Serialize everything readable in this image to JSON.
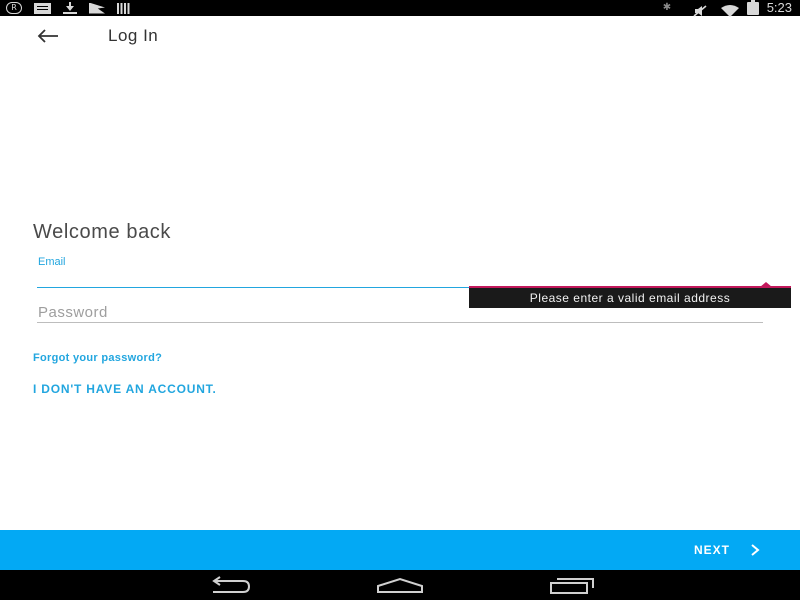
{
  "status_bar": {
    "left_icons": [
      "r-badge-icon",
      "message-icon",
      "download-icon",
      "play-store-icon",
      "barcode-icon"
    ],
    "right_icons": [
      "bluetooth-icon",
      "mute-icon",
      "wifi-icon",
      "battery-icon"
    ],
    "r_badge": "R",
    "time": "5:23"
  },
  "toolbar": {
    "back_icon": "arrow-left-icon",
    "title": "Log In"
  },
  "form": {
    "heading": "Welcome back",
    "email": {
      "label": "Email",
      "value": ""
    },
    "error_tooltip": "Please enter a valid email address",
    "password": {
      "placeholder": "Password",
      "value": ""
    },
    "forgot_link": "Forgot your password?",
    "no_account_link": "I DON'T HAVE AN ACCOUNT."
  },
  "action_bar": {
    "next_label": "NEXT",
    "next_icon": "chevron-right-icon"
  },
  "nav_bar": {
    "buttons": [
      "back-nav-icon",
      "home-nav-icon",
      "recents-nav-icon"
    ]
  },
  "colors": {
    "accent": "#22a6df",
    "action_bar": "#03a9f4",
    "error": "#c2185b",
    "tooltip_bg": "#1a1a1a",
    "text": "#4a4a4a"
  }
}
